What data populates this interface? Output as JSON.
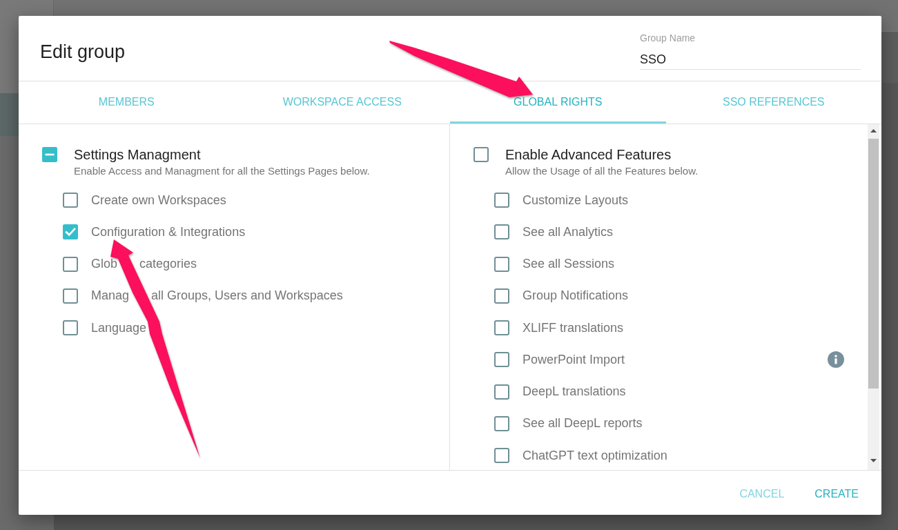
{
  "dialog": {
    "title": "Edit group",
    "group_name": {
      "label": "Group Name",
      "value": "SSO"
    },
    "tabs": [
      {
        "label": "MEMBERS",
        "selected": false
      },
      {
        "label": "WORKSPACE ACCESS",
        "selected": false
      },
      {
        "label": "GLOBAL RIGHTS",
        "selected": true
      },
      {
        "label": "SSO REFERENCES",
        "selected": false
      }
    ],
    "sections": [
      {
        "title": "Settings Managment",
        "description": "Enable Access and Managment for all the Settings Pages below.",
        "checked": false,
        "indeterminate": true,
        "items": [
          {
            "label_parts": [
              "Create own Workspaces"
            ],
            "checked": false,
            "info": false
          },
          {
            "label_parts": [
              "Configuration & Integrations"
            ],
            "checked": true,
            "info": false
          },
          {
            "label_parts": [
              "Glob",
              "categories"
            ],
            "checked": false,
            "info": false
          },
          {
            "label_parts": [
              "Manag",
              "all Groups, Users and Workspaces"
            ],
            "checked": false,
            "info": false
          },
          {
            "label_parts": [
              "Language"
            ],
            "checked": false,
            "info": false
          }
        ]
      },
      {
        "title": "Enable Advanced Features",
        "description": "Allow the Usage of all the Features below.",
        "checked": false,
        "indeterminate": false,
        "items": [
          {
            "label_parts": [
              "Customize Layouts"
            ],
            "checked": false,
            "info": false
          },
          {
            "label_parts": [
              "See all Analytics"
            ],
            "checked": false,
            "info": false
          },
          {
            "label_parts": [
              "See all Sessions"
            ],
            "checked": false,
            "info": false
          },
          {
            "label_parts": [
              "Group Notifications"
            ],
            "checked": false,
            "info": false
          },
          {
            "label_parts": [
              "XLIFF translations"
            ],
            "checked": false,
            "info": false
          },
          {
            "label_parts": [
              "PowerPoint Import"
            ],
            "checked": false,
            "info": true
          },
          {
            "label_parts": [
              "DeepL translations"
            ],
            "checked": false,
            "info": false
          },
          {
            "label_parts": [
              "See all DeepL reports"
            ],
            "checked": false,
            "info": false
          },
          {
            "label_parts": [
              "ChatGPT text optimization"
            ],
            "checked": false,
            "info": false
          }
        ]
      }
    ],
    "buttons": [
      {
        "label": "CANCEL",
        "kind": "secondary"
      },
      {
        "label": "CREATE",
        "kind": "primary"
      }
    ]
  },
  "annotations": [
    {
      "kind": "arrow"
    },
    {
      "kind": "arrow"
    }
  ]
}
